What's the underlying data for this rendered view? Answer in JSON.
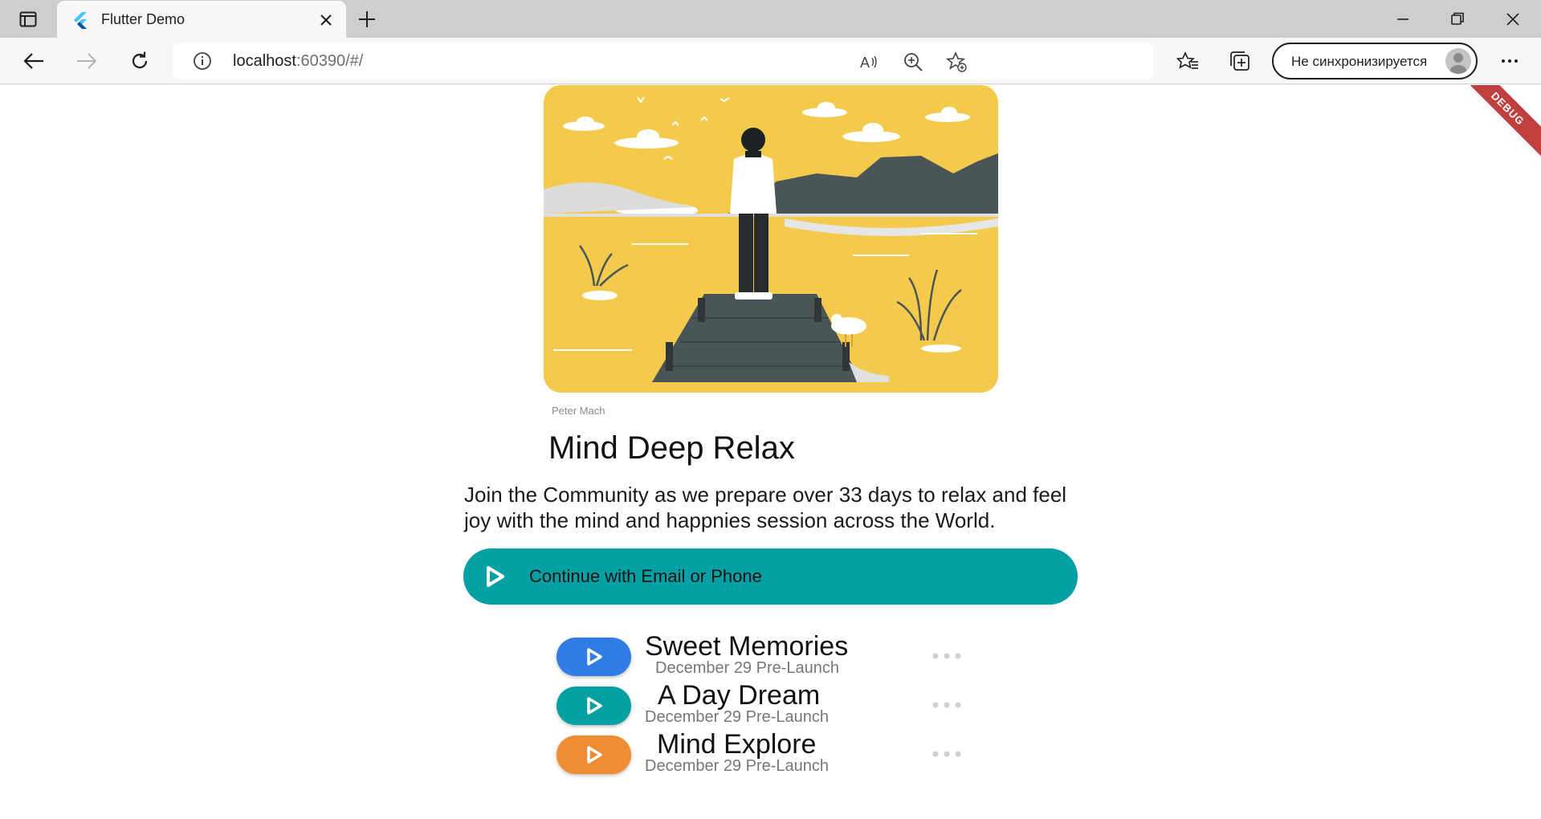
{
  "browser": {
    "tab": {
      "title": "Flutter Demo"
    },
    "address": {
      "host": "localhost",
      "rest": ":60390/#/"
    },
    "sync_label": "Не синхронизируется"
  },
  "app": {
    "debug_label": "DEBUG",
    "image_credit": "Peter Mach",
    "title": "Mind Deep Relax",
    "description": "Join the Community as we prepare over 33 days to relax and feel joy with the mind and happnies session across the World.",
    "cta_label": "Continue with Email or Phone",
    "colors": {
      "cta": "#05a0a3",
      "hero_bg": "#f3ca4c"
    },
    "tracks": [
      {
        "name": "Sweet Memories",
        "subtitle": "December 29 Pre-Launch",
        "color": "#2f7de5"
      },
      {
        "name": "A Day Dream",
        "subtitle": "December 29 Pre-Launch",
        "color": "#05a0a3"
      },
      {
        "name": "Mind Explore",
        "subtitle": "December 29 Pre-Launch",
        "color": "#f08c33"
      }
    ]
  }
}
